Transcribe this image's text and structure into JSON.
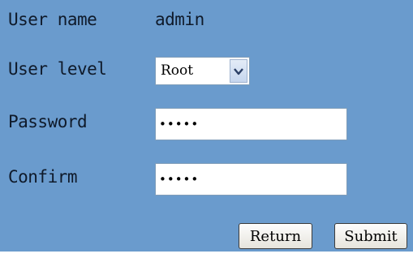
{
  "form": {
    "username_label": "User name",
    "username_value": "admin",
    "level_label": "User level",
    "level_value": "Root",
    "password_label": "Password",
    "password_value": "•••••",
    "confirm_label": "Confirm",
    "confirm_value": "•••••"
  },
  "buttons": {
    "return_label": "Return",
    "submit_label": "Submit"
  },
  "icons": {
    "dropdown": "chevron-down-icon"
  },
  "colors": {
    "panel_bg": "#6a9bcd",
    "text": "#0f1a2a"
  }
}
